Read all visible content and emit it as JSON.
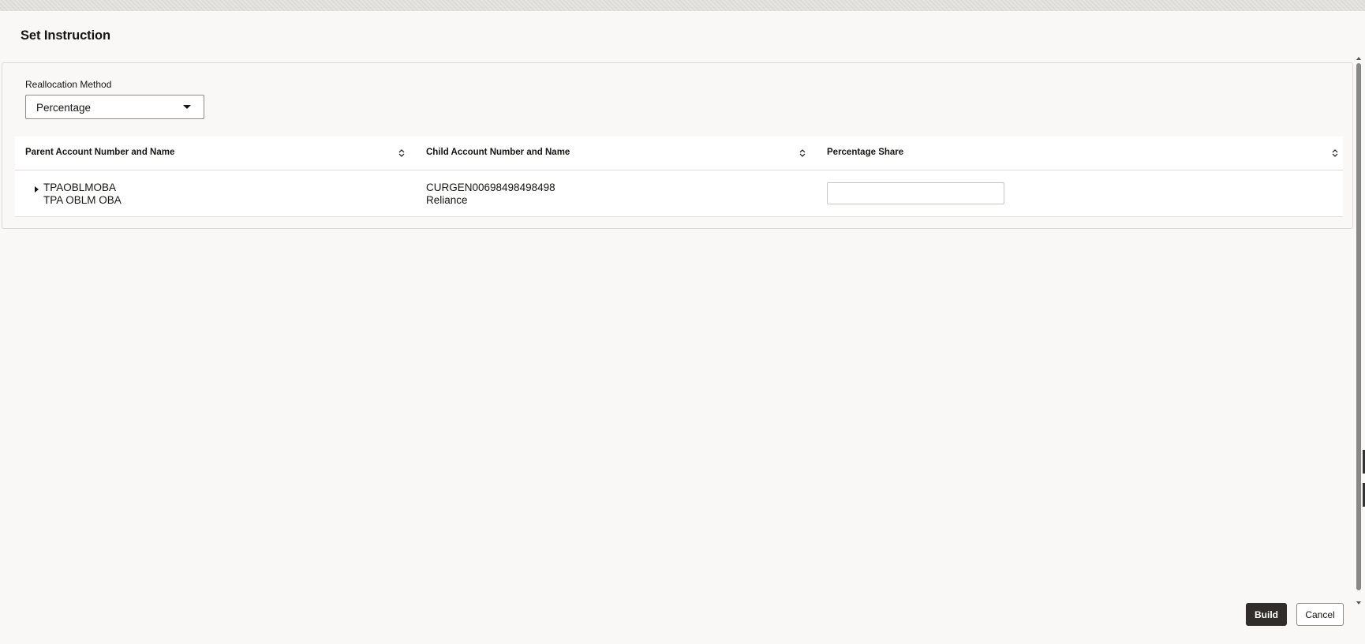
{
  "dialog": {
    "title": "Set Instruction"
  },
  "form": {
    "reallocation_method_label": "Reallocation Method",
    "reallocation_method_value": "Percentage"
  },
  "table": {
    "columns": [
      {
        "label": "Parent Account Number and Name"
      },
      {
        "label": "Child Account Number and Name"
      },
      {
        "label": "Percentage Share"
      }
    ],
    "rows": [
      {
        "parent_account_number": "TPAOBLMOBA",
        "parent_account_name": "TPA OBLM OBA",
        "child_account_number": "CURGEN00698498498498",
        "child_account_name": "Reliance",
        "percentage_share": ""
      }
    ]
  },
  "buttons": {
    "build_label": "Build",
    "cancel_label": "Cancel"
  },
  "icons": {
    "sort": "sort-icon",
    "dropdown": "chevron-down-icon",
    "expand": "expand-arrow-icon"
  },
  "colors": {
    "primary_button_bg": "#312d2a",
    "dialog_bg": "#f9f8f6",
    "border": "#dcd9d5"
  }
}
